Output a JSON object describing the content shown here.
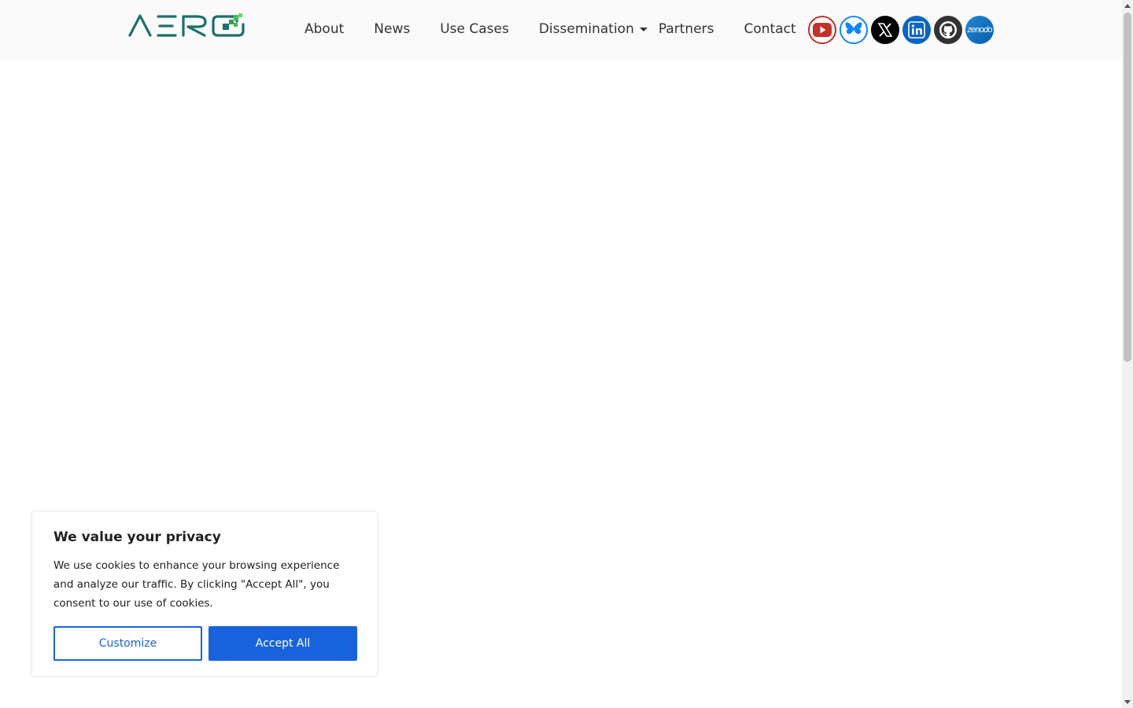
{
  "brand": {
    "logo_text": "AERO"
  },
  "nav": {
    "items": [
      {
        "label": "About"
      },
      {
        "label": "News"
      },
      {
        "label": "Use Cases"
      },
      {
        "label": "Dissemination"
      },
      {
        "label": "Partners"
      },
      {
        "label": "Contact"
      }
    ]
  },
  "socials": [
    {
      "icon": "youtube-icon",
      "color": "#c4302b"
    },
    {
      "icon": "bluesky-icon",
      "color": "#1185fe"
    },
    {
      "icon": "x-icon",
      "color": "#000000"
    },
    {
      "icon": "linkedin-icon",
      "color": "#0a66c2"
    },
    {
      "icon": "github-icon",
      "color": "#333333"
    },
    {
      "icon": "zenodo-icon",
      "color": "#1d8ad8",
      "label": "zenodo"
    }
  ],
  "cookie_banner": {
    "title": "We value your privacy",
    "text": "We use cookies to enhance your browsing experience and analyze our traffic. By clicking \"Accept All\", you consent to our use of cookies.",
    "customize_label": "Customize",
    "accept_label": "Accept All",
    "accent_color": "#1863dc"
  }
}
